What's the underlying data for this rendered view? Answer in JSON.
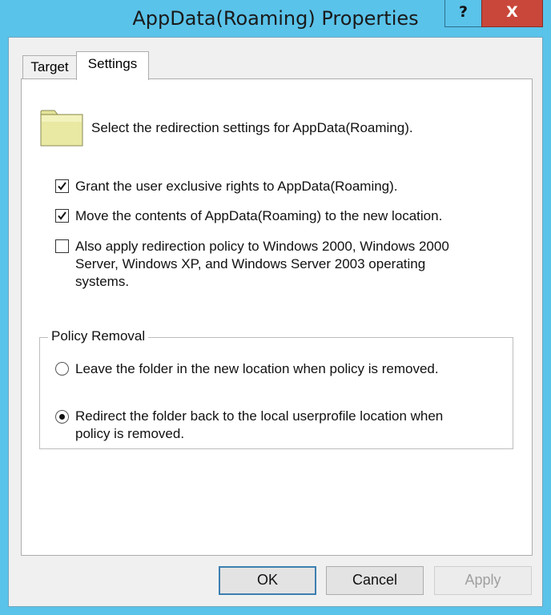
{
  "window": {
    "title": "AppData(Roaming) Properties",
    "help_label": "?",
    "close_label": "X",
    "accent_color": "#5ac3ea",
    "close_color": "#c9473a"
  },
  "tabs": [
    {
      "label": "Target",
      "selected": false
    },
    {
      "label": "Settings",
      "selected": true
    }
  ],
  "settings": {
    "header_text": "Select the redirection settings for AppData(Roaming).",
    "header_icon": "folder-icon",
    "options": [
      {
        "label": "Grant the user exclusive rights to AppData(Roaming).",
        "checked": true
      },
      {
        "label": "Move the contents of AppData(Roaming) to the new location.",
        "checked": true
      },
      {
        "label_lines": [
          "Also apply redirection policy to Windows 2000, Windows 2000",
          "Server, Windows XP, and Windows Server 2003 operating",
          "systems."
        ],
        "checked": false
      }
    ]
  },
  "policy_removal": {
    "legend": "Policy Removal",
    "options": [
      {
        "label": "Leave the folder in the new location when policy is removed.",
        "selected": false
      },
      {
        "label_lines": [
          "Redirect the folder back to the local userprofile location when",
          "policy is removed."
        ],
        "selected": true
      }
    ]
  },
  "buttons": {
    "ok": "OK",
    "cancel": "Cancel",
    "apply": "Apply",
    "apply_enabled": false
  }
}
